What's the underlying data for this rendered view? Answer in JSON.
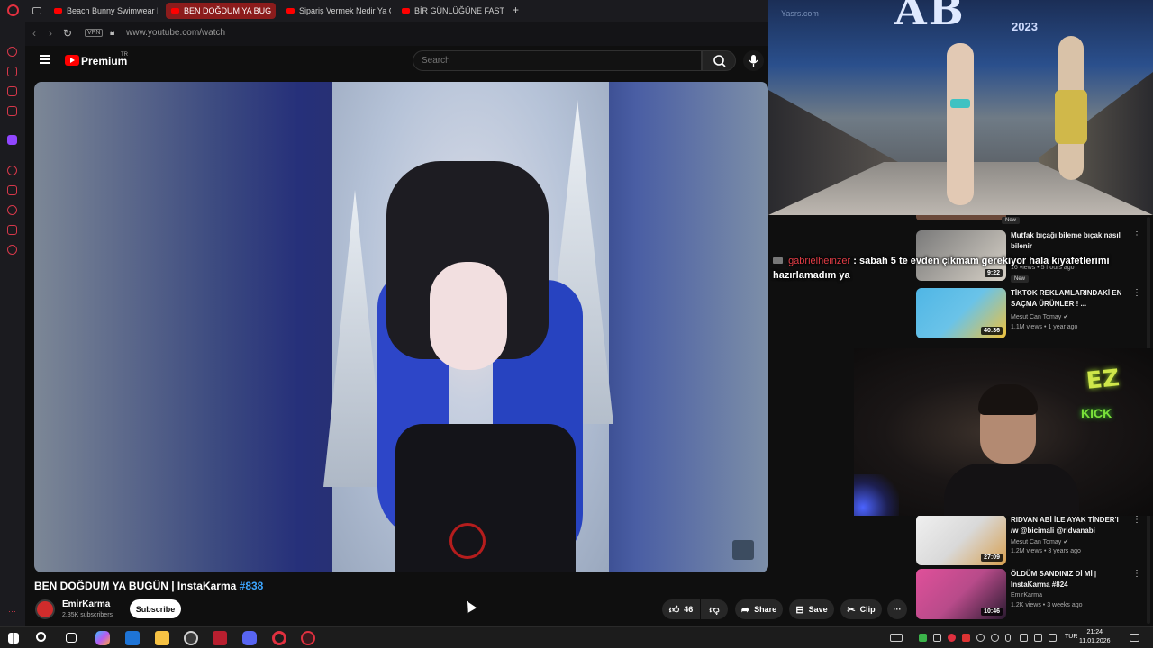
{
  "browser": {
    "tabs": [
      {
        "label": "Beach Bunny Swimwear F",
        "active": false
      },
      {
        "label": "BEN DOĞDUM YA BUG",
        "active": true
      },
      {
        "label": "Sipariş Vermek Nedir Ya C",
        "active": false
      },
      {
        "label": "BİR GÜNLÜĞÜNE FAST FC",
        "active": false
      }
    ],
    "new_tab": "+",
    "vpn": "VPN",
    "url": "www.youtube.com/watch"
  },
  "youtube": {
    "brand": "Premium",
    "country": "TR",
    "search_placeholder": "Search"
  },
  "video": {
    "title": "BEN DOĞDUM YA BUGÜN | InstaKarma",
    "title_tag": "#838",
    "channel": "EmirKarma",
    "subscribers": "2.35K subscribers",
    "subscribe_label": "Subscribe",
    "likes": "46",
    "share_label": "Share",
    "save_label": "Save",
    "clip_label": "Clip",
    "more_label": "···"
  },
  "pip": {
    "logo_text": "AB",
    "year": "2023",
    "site": "Yasrs.com"
  },
  "chat": {
    "user": "gabrielheinzer",
    "message": ": sabah 5 te evden çıkmam gerekiyor hala kıyafetlerimi hazırlamadım ya"
  },
  "cam": {
    "sign_line1": "EZ",
    "sign_line2": "KICK"
  },
  "recommendations": [
    {
      "title": "Mutfak bıçağı bileme bıçak nasıl bilenir",
      "channel": "",
      "meta": "16 views • 5 hours ago",
      "badge": "New",
      "duration": "9:22",
      "thumb_colors": [
        "#6b6b6b",
        "#c9c3b8"
      ]
    },
    {
      "title": "TİKTOK REKLAMLARINDAKİ EN SAÇMA ÜRÜNLER ! ...",
      "channel": "Mesut Can Tomay ✔",
      "meta": "1.1M views • 1 year ago",
      "badge": "",
      "duration": "40:36",
      "thumb_colors": [
        "#4fb6e6",
        "#f0c23a"
      ]
    },
    {
      "title": "RIDVAN ABİ İLE AYAK TİNDER'I /w @bicimali @ridvanabi",
      "channel": "Mesut Can Tomay ✔",
      "meta": "1.2M views • 3 years ago",
      "badge": "",
      "duration": "27:09",
      "thumb_colors": [
        "#e8e8e8",
        "#d8a050"
      ]
    },
    {
      "title": "ÖLDÜM SANDINIZ Dİ Mİ | InstaKarma #824",
      "channel": "EmirKarma",
      "meta": "1.2K views • 3 weeks ago",
      "badge": "",
      "duration": "10:46",
      "thumb_colors": [
        "#e0509a",
        "#2a1a30"
      ]
    }
  ],
  "top_badge": "New",
  "taskbar": {
    "lang": "TUR",
    "time": "21:24",
    "date": "11.01.2026"
  }
}
